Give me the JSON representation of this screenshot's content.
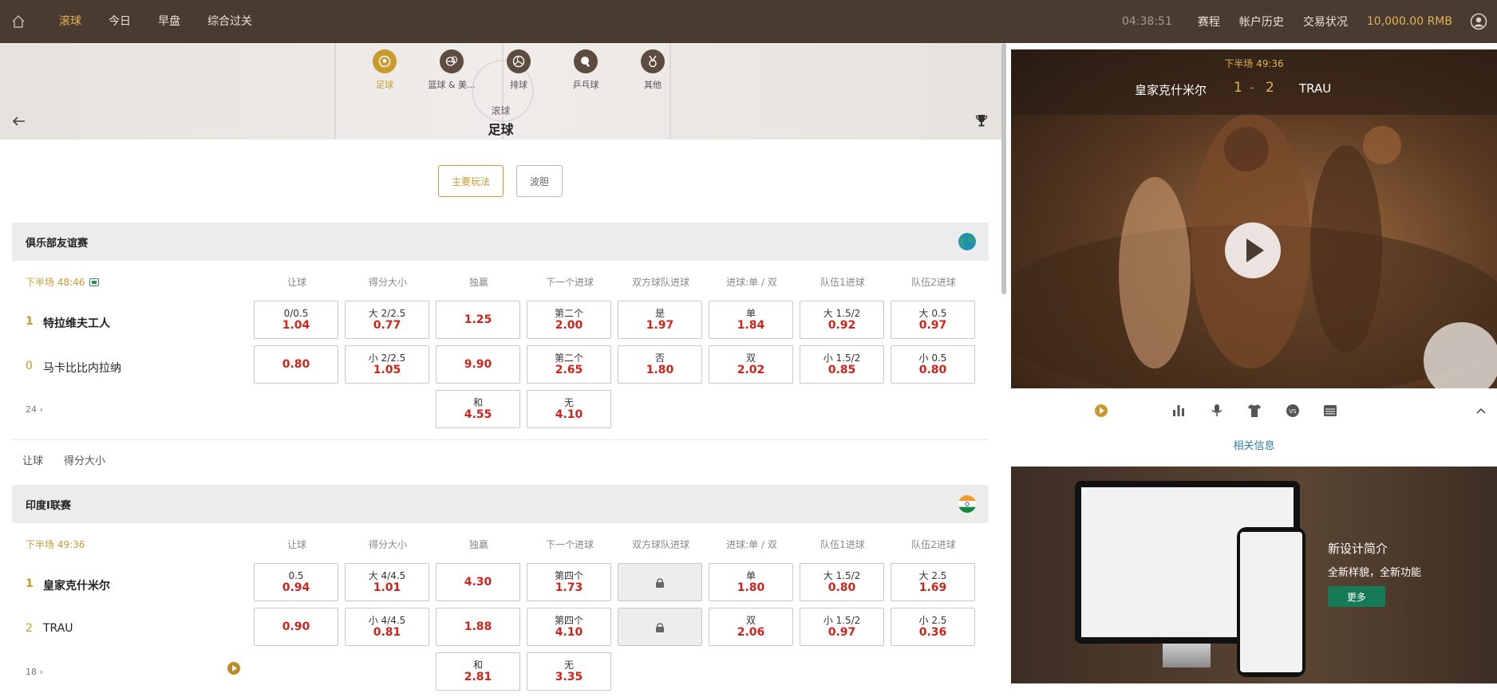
{
  "topbar": {
    "nav": [
      "滚球",
      "今日",
      "早盘",
      "综合过关"
    ],
    "active_index": 0,
    "clock": "04:38:51",
    "links": [
      "赛程",
      "帐户历史",
      "交易状况"
    ],
    "balance": "10,000.00 RMB"
  },
  "sports": [
    {
      "label": "足球",
      "icon": "soccer-icon",
      "active": true
    },
    {
      "label": "篮球 & 美...",
      "icon": "basketball-icon",
      "active": false
    },
    {
      "label": "排球",
      "icon": "volleyball-icon",
      "active": false
    },
    {
      "label": "乒乓球",
      "icon": "table-tennis-icon",
      "active": false
    },
    {
      "label": "其他",
      "icon": "medal-icon",
      "active": false
    }
  ],
  "header": {
    "sub": "滚球",
    "title": "足球"
  },
  "market_tabs": [
    "主要玩法",
    "波胆"
  ],
  "columns": [
    "让球",
    "得分大小",
    "独赢",
    "下一个进球",
    "双方球队进球",
    "进球:单 / 双",
    "队伍1进球",
    "队伍2进球"
  ],
  "leagues": [
    {
      "name": "俱乐部友谊赛",
      "time": "下半场  48:46",
      "more": "24",
      "home": {
        "name": "特拉维夫工人",
        "score": "1"
      },
      "away": {
        "name": "马卡比比内拉纳",
        "score": "0"
      },
      "row1": [
        {
          "t": "0/0.5",
          "o": "1.04"
        },
        {
          "t": "大 2/2.5",
          "o": "0.77"
        },
        {
          "t": "",
          "o": "1.25"
        },
        {
          "t": "第二个",
          "o": "2.00"
        },
        {
          "t": "是",
          "o": "1.97"
        },
        {
          "t": "单",
          "o": "1.84"
        },
        {
          "t": "大 1.5/2",
          "o": "0.92"
        },
        {
          "t": "大 0.5",
          "o": "0.97"
        }
      ],
      "row2": [
        {
          "t": "",
          "o": "0.80"
        },
        {
          "t": "小 2/2.5",
          "o": "1.05"
        },
        {
          "t": "",
          "o": "9.90"
        },
        {
          "t": "第二个",
          "o": "2.65"
        },
        {
          "t": "否",
          "o": "1.80"
        },
        {
          "t": "双",
          "o": "2.02"
        },
        {
          "t": "小 1.5/2",
          "o": "0.85"
        },
        {
          "t": "小 0.5",
          "o": "0.80"
        }
      ],
      "row3": [
        {
          "t": "和",
          "o": "4.55"
        },
        {
          "t": "无",
          "o": "4.10"
        }
      ]
    },
    {
      "name": "印度I联赛",
      "time": "下半场  49:36",
      "more": "18",
      "home": {
        "name": "皇家克什米尔",
        "score": "1"
      },
      "away": {
        "name": "TRAU",
        "score": "2"
      },
      "row1": [
        {
          "t": "0.5",
          "o": "0.94"
        },
        {
          "t": "大 4/4.5",
          "o": "1.01"
        },
        {
          "t": "",
          "o": "4.30"
        },
        {
          "t": "第四个",
          "o": "1.73"
        },
        {
          "t": "",
          "o": "",
          "locked": true
        },
        {
          "t": "单",
          "o": "1.80"
        },
        {
          "t": "大 1.5/2",
          "o": "0.80"
        },
        {
          "t": "大 2.5",
          "o": "1.69"
        }
      ],
      "row2": [
        {
          "t": "",
          "o": "0.90"
        },
        {
          "t": "小 4/4.5",
          "o": "0.81"
        },
        {
          "t": "",
          "o": "1.88"
        },
        {
          "t": "第四个",
          "o": "4.10"
        },
        {
          "t": "",
          "o": "",
          "locked": true
        },
        {
          "t": "双",
          "o": "2.06"
        },
        {
          "t": "小 1.5/2",
          "o": "0.97"
        },
        {
          "t": "小 2.5",
          "o": "0.36"
        }
      ],
      "row3": [
        {
          "t": "和",
          "o": "2.81"
        },
        {
          "t": "无",
          "o": "3.35"
        }
      ]
    }
  ],
  "subtabs": [
    "让球",
    "得分大小"
  ],
  "video": {
    "period": "下半场  49:36",
    "home": "皇家克什米尔",
    "home_score": "1",
    "sep": "-",
    "away_score": "2",
    "away": "TRAU"
  },
  "related_label": "相关信息",
  "promo": {
    "title": "新设计简介",
    "desc": "全新样貌，全新功能",
    "button": "更多"
  },
  "colors": {
    "accent": "#c99a2e",
    "topbar": "#4a3b30",
    "odds": "#d0241a",
    "link": "#2e7fb0",
    "promo_button": "#177a57"
  }
}
